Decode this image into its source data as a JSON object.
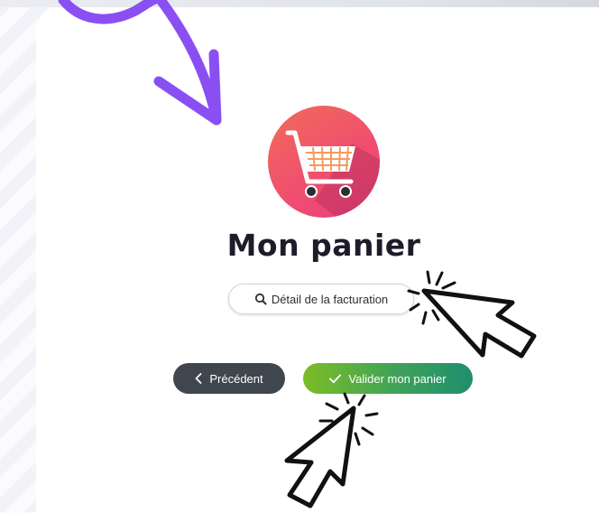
{
  "page": {
    "title": "Mon panier"
  },
  "billing_detail": {
    "label": "Détail de la facturation",
    "icon": "search-icon"
  },
  "actions": {
    "previous_label": "Précédent",
    "previous_icon": "chevron-left-icon",
    "validate_label": "Valider mon panier",
    "validate_icon": "check-icon"
  },
  "colors": {
    "annotation_arrow": "#8a4ff3",
    "cart_circle_start": "#f06d59",
    "cart_circle_end": "#e53f7c",
    "previous_button": "#3f464e",
    "validate_button_start": "#7cbd24",
    "validate_button_end": "#208e6e"
  }
}
